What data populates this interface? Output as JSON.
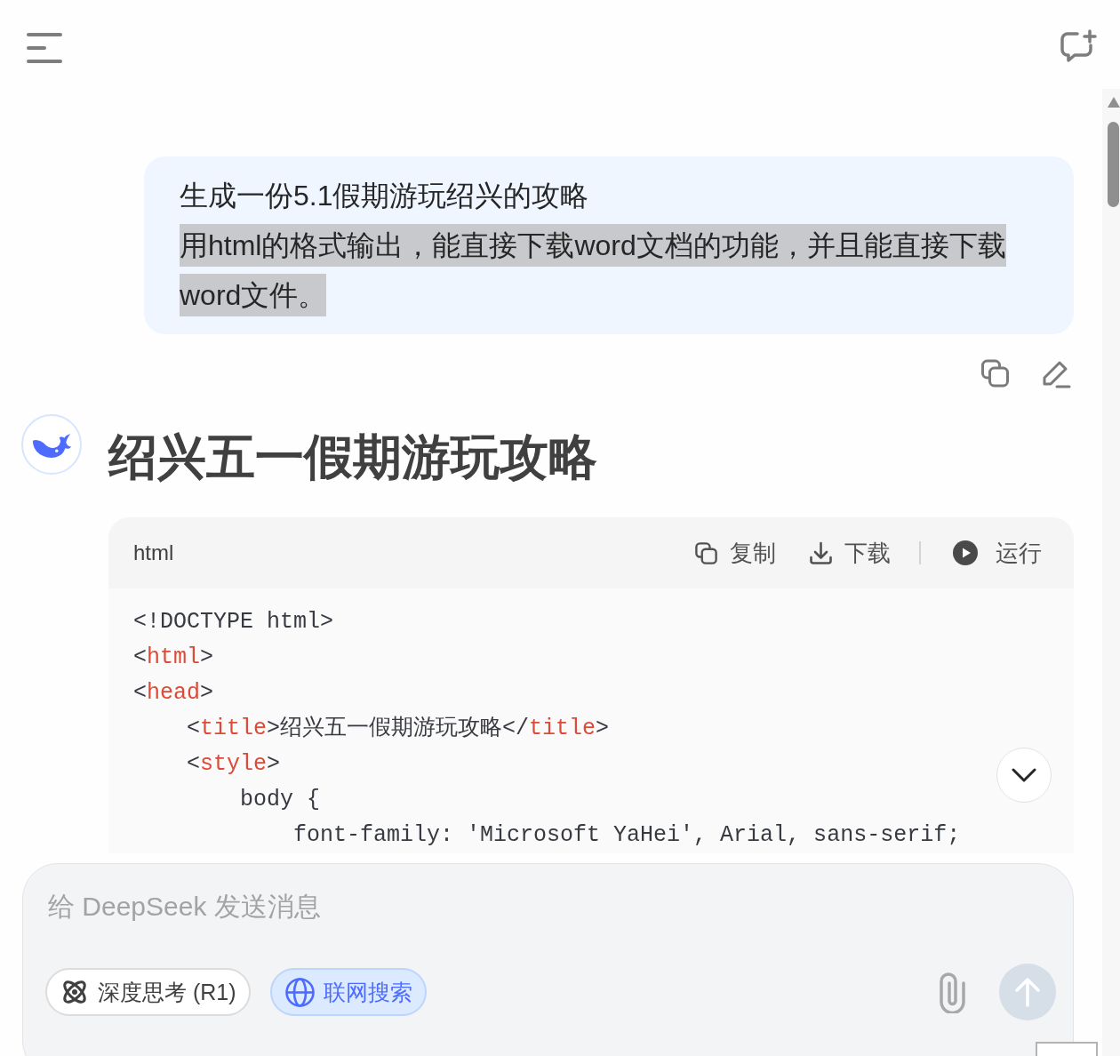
{
  "user_message": {
    "paragraphs": [
      {
        "text": "生成一份5.1假期游玩绍兴的攻略",
        "highlighted": false
      },
      {
        "text": "用html的格式输出，能直接下载word文档的功能，并且能直接下载word文件。",
        "highlighted": true
      }
    ]
  },
  "assistant_message": {
    "heading": "绍兴五一假期游玩攻略",
    "code_block": {
      "language": "html",
      "actions": [
        {
          "kind": "copy",
          "label": "复制"
        },
        {
          "kind": "download",
          "label": "下载"
        },
        {
          "kind": "run",
          "label": "运行"
        }
      ],
      "lines": [
        [
          {
            "kind": "text",
            "text": "<!DOCTYPE html>"
          }
        ],
        [
          {
            "kind": "text",
            "text": "<"
          },
          {
            "kind": "tag",
            "text": "html"
          },
          {
            "kind": "text",
            "text": ">"
          }
        ],
        [
          {
            "kind": "text",
            "text": "<"
          },
          {
            "kind": "tag",
            "text": "head"
          },
          {
            "kind": "text",
            "text": ">"
          }
        ],
        [
          {
            "kind": "text",
            "text": "    <"
          },
          {
            "kind": "tag",
            "text": "title"
          },
          {
            "kind": "text",
            "text": ">绍兴五一假期游玩攻略</"
          },
          {
            "kind": "tag",
            "text": "title"
          },
          {
            "kind": "text",
            "text": ">"
          }
        ],
        [
          {
            "kind": "text",
            "text": "    <"
          },
          {
            "kind": "tag",
            "text": "style"
          },
          {
            "kind": "text",
            "text": ">"
          }
        ],
        [
          {
            "kind": "text",
            "text": "        body {"
          }
        ],
        [
          {
            "kind": "text",
            "text": "            font-family: 'Microsoft YaHei', Arial, sans-serif;"
          }
        ]
      ]
    }
  },
  "composer": {
    "placeholder": "给 DeepSeek 发送消息",
    "toggles": [
      {
        "kind": "deep-think",
        "label": "深度思考 (R1)",
        "on": false
      },
      {
        "kind": "web-search",
        "label": "联网搜索",
        "on": true
      }
    ],
    "send_button": {
      "disabled": true
    }
  }
}
